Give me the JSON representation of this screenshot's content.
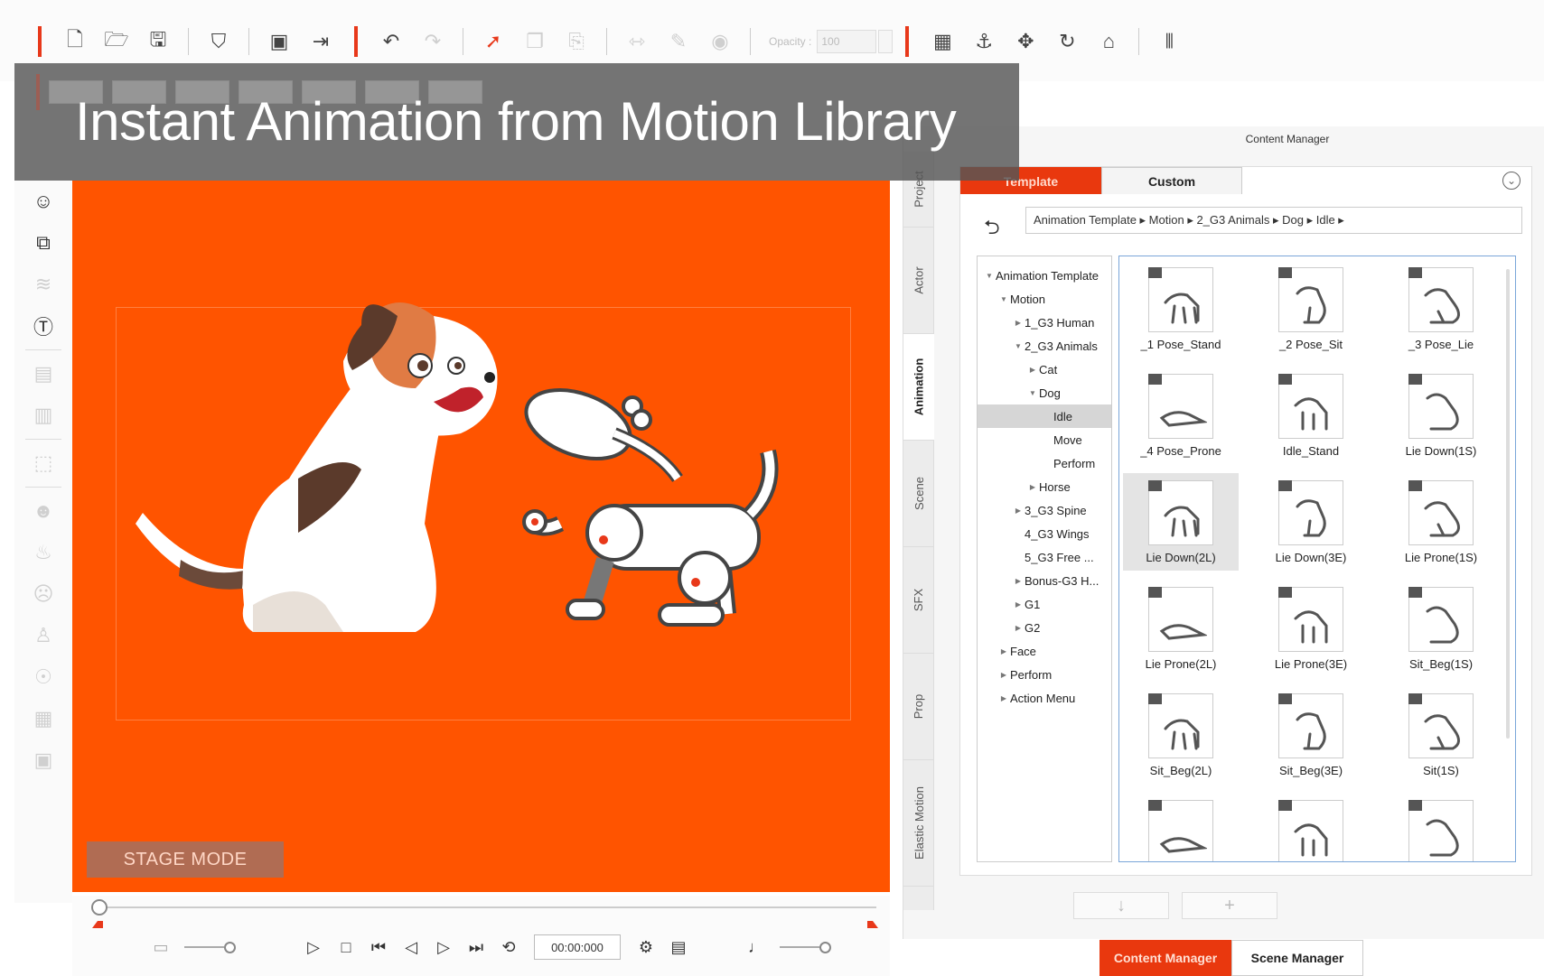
{
  "banner": {
    "title": "Instant Animation from Motion Library"
  },
  "toolbar": {
    "opacity_label": "Opacity :",
    "opacity_value": "100"
  },
  "stage": {
    "mode_label": "STAGE MODE"
  },
  "playback": {
    "timecode": "00:00:000"
  },
  "content_manager": {
    "title": "Content Manager",
    "side_tabs": [
      "Project",
      "Actor",
      "Animation",
      "Scene",
      "SFX",
      "Prop",
      "Elastic Motion"
    ],
    "active_side_tab": "Animation",
    "tabs": {
      "template": "Template",
      "custom": "Custom"
    },
    "breadcrumb": "Animation Template ▸ Motion ▸ 2_G3 Animals ▸ Dog ▸ Idle ▸",
    "tree": [
      {
        "label": "Animation Template",
        "level": 0,
        "expander": "open"
      },
      {
        "label": "Motion",
        "level": 1,
        "expander": "open"
      },
      {
        "label": "1_G3 Human",
        "level": 2,
        "expander": "closed"
      },
      {
        "label": "2_G3 Animals",
        "level": 2,
        "expander": "open"
      },
      {
        "label": "Cat",
        "level": 3,
        "expander": "closed"
      },
      {
        "label": "Dog",
        "level": 3,
        "expander": "open"
      },
      {
        "label": "Idle",
        "level": 4,
        "expander": "none",
        "selected": true
      },
      {
        "label": "Move",
        "level": 4,
        "expander": "none"
      },
      {
        "label": "Perform",
        "level": 4,
        "expander": "none"
      },
      {
        "label": "Horse",
        "level": 3,
        "expander": "closed"
      },
      {
        "label": "3_G3 Spine",
        "level": 2,
        "expander": "closed"
      },
      {
        "label": "4_G3 Wings",
        "level": 2,
        "expander": "none"
      },
      {
        "label": "5_G3 Free ...",
        "level": 2,
        "expander": "none"
      },
      {
        "label": "Bonus-G3 H...",
        "level": 2,
        "expander": "closed"
      },
      {
        "label": "G1",
        "level": 2,
        "expander": "closed"
      },
      {
        "label": "G2",
        "level": 2,
        "expander": "closed"
      },
      {
        "label": "Face",
        "level": 1,
        "expander": "closed"
      },
      {
        "label": "Perform",
        "level": 1,
        "expander": "closed"
      },
      {
        "label": "Action Menu",
        "level": 1,
        "expander": "closed"
      }
    ],
    "items": [
      "_1 Pose_Stand",
      "_2 Pose_Sit",
      "_3 Pose_Lie",
      "_4 Pose_Prone",
      "Idle_Stand",
      "Lie Down(1S)",
      "Lie Down(2L)",
      "Lie Down(3E)",
      "Lie Prone(1S)",
      "Lie Prone(2L)",
      "Lie Prone(3E)",
      "Sit_Beg(1S)",
      "Sit_Beg(2L)",
      "Sit_Beg(3E)",
      "Sit(1S)",
      "",
      "",
      ""
    ],
    "selected_item": "Lie Down(2L)",
    "bottom_tabs": {
      "content_manager": "Content Manager",
      "scene_manager": "Scene Manager"
    }
  },
  "colors": {
    "accent": "#e9380e",
    "stage": "#ff5400",
    "selection_border": "#7aa6d8"
  }
}
